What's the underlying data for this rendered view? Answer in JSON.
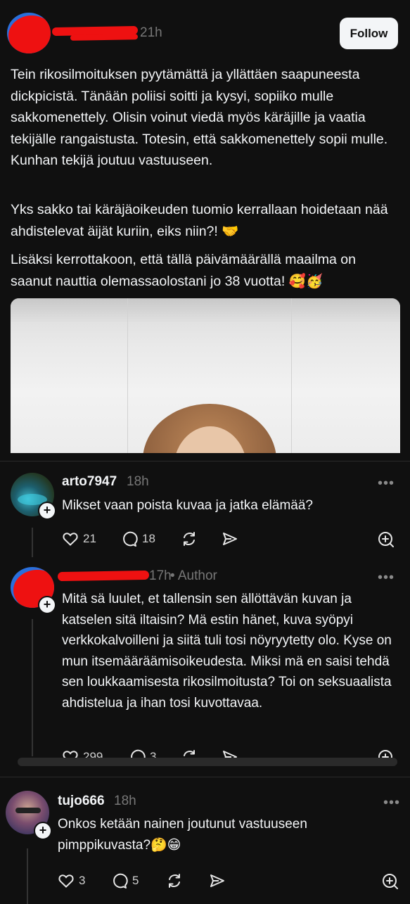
{
  "post": {
    "time": "21h",
    "follow_label": "Follow",
    "paragraph1": "Tein rikosilmoituksen pyytämättä ja yllättäen saapuneesta dickpicistä. Tänään poliisi soitti ja kysyi, sopiiko mulle sakkomenettely. Olisin voinut viedä myös käräjille ja vaatia tekijälle rangaistusta. Totesin, että sakkomenettely sopii mulle. Kunhan tekijä joutuu vastuuseen.",
    "paragraph2": "Yks sakko tai käräjäoikeuden tuomio kerrallaan hoidetaan nää ahdistelevat äijät kuriin, eiks niin?! 🤝",
    "paragraph3": "Lisäksi kerrottakoon, että tällä päivämäärällä maailma on saanut nauttia olemassaolostani jo 38 vuotta! 🥰🥳"
  },
  "comments": [
    {
      "username": "arto7947",
      "time": "18h",
      "text": "Mikset vaan poista kuvaa ja jatka elämää?",
      "likes": "21",
      "replies": "18"
    },
    {
      "time": "17h",
      "author_tag": "• Author",
      "text": "Mitä sä luulet, et tallensin sen ällöttävän kuvan ja katselen sitä iltaisin? Mä estin hänet, kuva syöpyi verkkokalvoilleni ja siitä tuli tosi nöyryytetty olo. Kyse on mun itsemääräämisoikeudesta. Miksi mä en saisi tehdä sen loukkaamisesta rikosilmoitusta? Toi on seksuaalista ahdistelua ja ihan tosi kuvottavaa.",
      "likes": "299",
      "replies": "3"
    },
    {
      "username": "tujo666",
      "time": "18h",
      "text": "Onkos ketään nainen joutunut vastuuseen pimppikuvasta?🤔😁",
      "likes": "3",
      "replies": "5"
    }
  ],
  "more_label": "•••",
  "plus_label": "+",
  "colors": {
    "background": "#101010",
    "text": "#f3f5f7",
    "muted": "#777777",
    "redaction": "#ee1111"
  }
}
